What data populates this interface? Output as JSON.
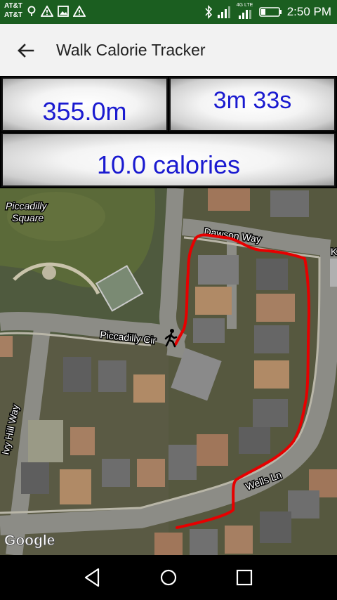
{
  "status_bar": {
    "carrier_line1": "AT&T",
    "carrier_line2": "AT&T",
    "network_label": "4G LTE",
    "time": "2:50 PM",
    "background_color": "#1b5e20"
  },
  "app_bar": {
    "title": "Walk Calorie Tracker",
    "back_icon": "arrow-back-icon"
  },
  "stats": {
    "distance": "355.0m",
    "duration": "3m 33s",
    "calories": "10.0 calories",
    "text_color": "#1a1ad0"
  },
  "map": {
    "labels": {
      "piccadilly_square_line1": "Piccadilly",
      "piccadilly_square_line2": "Square",
      "dawson_way": "Dawson Way",
      "piccadilly_cir": "Piccadilly Cir",
      "ivy_hill_way": "Ivy Hill Way",
      "wells_ln": "Wells Ln",
      "edge_label": "K"
    },
    "attribution": "Google",
    "route_color": "#e60000",
    "walker_icon": "walking-person-icon"
  },
  "nav_bar": {
    "back_icon": "nav-back-icon",
    "home_icon": "nav-home-icon",
    "recents_icon": "nav-recents-icon"
  }
}
